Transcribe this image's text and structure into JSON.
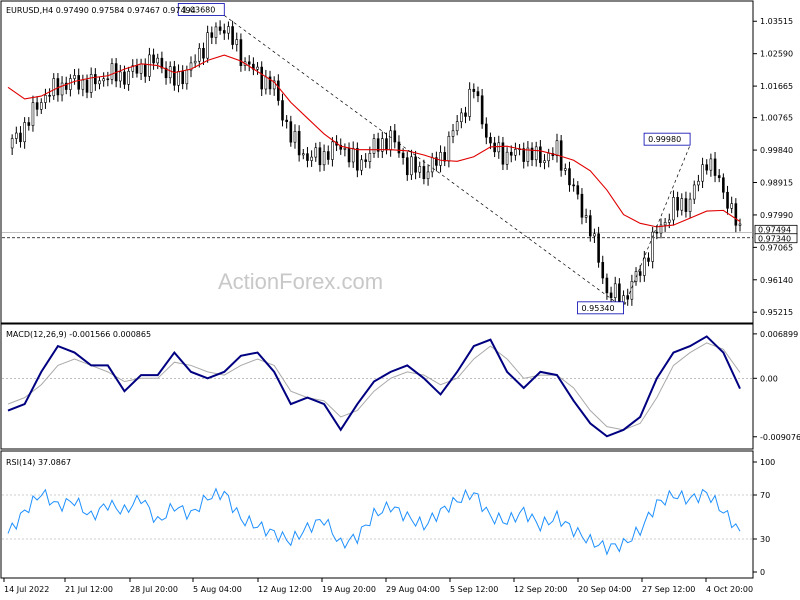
{
  "chart_data": {
    "symbol_info": "EURUSD,H4  0.97490 0.97584 0.97467 0.97494",
    "watermark": "ActionForex.com",
    "x_labels": [
      "14 Jul 2022",
      "21 Jul 12:00",
      "28 Jul 20:00",
      "5 Aug 04:00",
      "12 Aug 12:00",
      "19 Aug 20:00",
      "29 Aug 04:00",
      "5 Sep 12:00",
      "12 Sep 20:00",
      "20 Sep 04:00",
      "27 Sep 12:00",
      "4 Oct 20:00"
    ],
    "price_panel": {
      "type": "candlestick",
      "y_ticks": [
        "1.03515",
        "1.02590",
        "1.01665",
        "1.00765",
        "0.99840",
        "0.98915",
        "0.97990",
        "0.97065",
        "0.96140",
        "0.95215"
      ],
      "ylim": [
        0.9505,
        1.0395
      ],
      "current_price": "0.97494",
      "level_price": "0.97340",
      "ma_line": [
        1.0163,
        1.013,
        1.0138,
        1.0162,
        1.018,
        1.019,
        1.0196,
        1.0215,
        1.023,
        1.0225,
        1.0205,
        1.0215,
        1.024,
        1.0255,
        1.0238,
        1.0208,
        1.0178,
        1.012,
        1.0075,
        1.003,
        0.9995,
        0.9985,
        0.9985,
        0.9985,
        0.9982,
        0.997,
        0.9955,
        0.9952,
        0.9965,
        0.9993,
        0.9995,
        0.9985,
        0.9982,
        0.997,
        0.9955,
        0.9925,
        0.987,
        0.98,
        0.9775,
        0.9765,
        0.977,
        0.979,
        0.981,
        0.9812,
        0.978
      ],
      "closes": [
        0.999,
        1.005,
        1.013,
        1.0165,
        1.018,
        1.017,
        1.02,
        1.0195,
        1.022,
        1.024,
        1.018,
        1.022,
        1.03,
        1.034,
        1.025,
        1.02,
        1.016,
        1.002,
        0.996,
        0.997,
        1.0,
        0.994,
        0.999,
        1.002,
        0.994,
        0.992,
        0.996,
        1.006,
        1.016,
        0.999,
        0.997,
        0.998,
        0.996,
        0.998,
        0.987,
        0.976,
        0.958,
        0.956,
        0.964,
        0.975,
        0.982,
        0.984,
        0.996,
        0.987,
        0.9749
      ],
      "annotations": [
        {
          "label": "1.03680",
          "x_index": 13,
          "price": 1.0368
        },
        {
          "label": "0.95340",
          "x_index": 37,
          "price": 0.9534
        },
        {
          "label": "0.99980",
          "x_index": 41,
          "price": 0.9998
        }
      ]
    },
    "macd_panel": {
      "label": "MACD(12,26,9) -0.001566 0.000865",
      "y_ticks": [
        "0.006899",
        "0.00",
        "-0.009076"
      ],
      "ylim": [
        -0.0102,
        0.0075
      ],
      "macd": [
        -0.005,
        -0.004,
        0.001,
        0.005,
        0.004,
        0.002,
        0.002,
        -0.002,
        0.0005,
        0.0005,
        0.004,
        0.001,
        0.0,
        0.001,
        0.0035,
        0.004,
        0.001,
        -0.004,
        -0.003,
        -0.004,
        -0.008,
        -0.004,
        -0.0005,
        0.001,
        0.002,
        0.0,
        -0.0025,
        0.001,
        0.005,
        0.006,
        0.001,
        -0.0015,
        0.001,
        0.0005,
        -0.0035,
        -0.007,
        -0.009,
        -0.008,
        -0.006,
        0.0,
        0.004,
        0.005,
        0.0065,
        0.004,
        -0.0016
      ],
      "signal": [
        -0.004,
        -0.003,
        -0.001,
        0.002,
        0.003,
        0.002,
        0.001,
        -0.0005,
        0.0,
        0.0,
        0.0025,
        0.002,
        0.001,
        0.0005,
        0.002,
        0.003,
        0.002,
        -0.002,
        -0.003,
        -0.0035,
        -0.006,
        -0.005,
        -0.002,
        0.0,
        0.001,
        0.0005,
        -0.001,
        0.0,
        0.003,
        0.005,
        0.003,
        0.0,
        0.0005,
        0.0005,
        -0.0015,
        -0.005,
        -0.0075,
        -0.008,
        -0.007,
        -0.003,
        0.002,
        0.004,
        0.0055,
        0.0045,
        0.0009
      ]
    },
    "rsi_panel": {
      "label": "RSI(14) 37.0867",
      "y_ticks": [
        "100",
        "70",
        "30",
        "0"
      ],
      "ylim": [
        0,
        100
      ],
      "levels": [
        70,
        30
      ],
      "rsi": [
        35,
        55,
        72,
        60,
        65,
        50,
        62,
        55,
        68,
        45,
        60,
        52,
        68,
        72,
        48,
        42,
        35,
        28,
        40,
        48,
        25,
        32,
        52,
        60,
        50,
        42,
        55,
        65,
        72,
        50,
        46,
        55,
        42,
        50,
        38,
        28,
        22,
        25,
        38,
        62,
        70,
        66,
        72,
        55,
        37
      ]
    }
  }
}
